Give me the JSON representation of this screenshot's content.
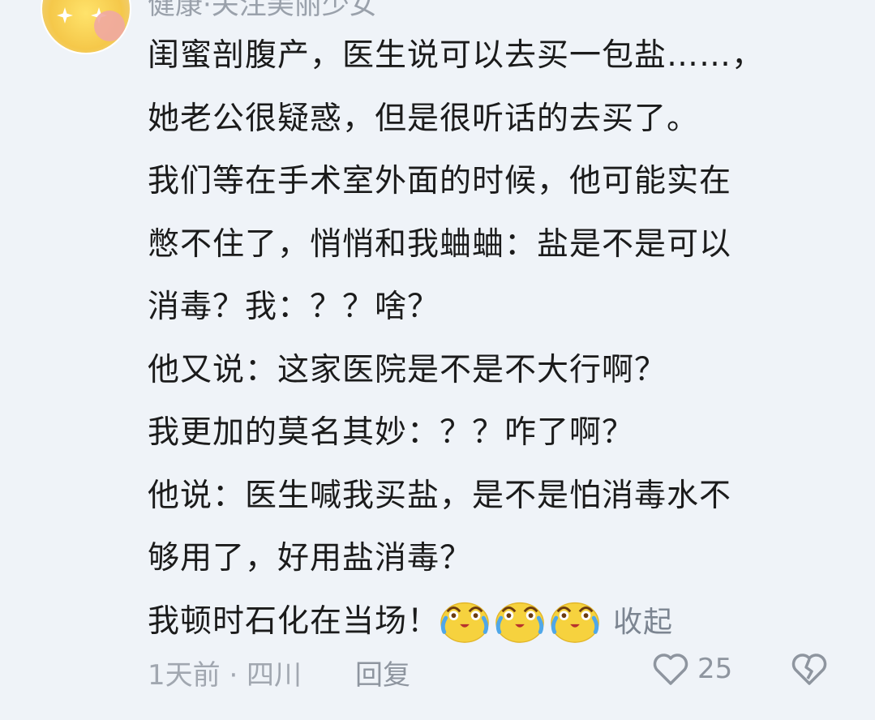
{
  "comment": {
    "author": "健康·关注美丽少女",
    "lines": [
      "闺蜜剖腹产，医生说可以去买一包盐……，",
      "她老公很疑惑，但是很听话的去买了。",
      "我们等在手术室外面的时候，他可能实在",
      "憋不住了，悄悄和我蛐蛐：盐是不是可以",
      "消毒？我：？？啥？",
      "他又说：这家医院是不是不大行啊？",
      "我更加的莫名其妙：？？咋了啊？",
      "他说：医生喊我买盐，是不是怕消毒水不",
      "够用了，好用盐消毒？",
      "我顿时石化在当场！"
    ],
    "emojis": [
      "crying-laughing-emoji",
      "crying-laughing-emoji",
      "crying-laughing-emoji"
    ],
    "collapse_label": "收起",
    "time_location": "1天前 · 四川",
    "reply_label": "回复",
    "like_count": "25"
  },
  "colors": {
    "background": "#eff3f8",
    "text": "#1b1b1b",
    "muted": "#a1a7b0",
    "emoji": "#f6d23e"
  },
  "icons": {
    "like": "heart-outline-icon",
    "dislike": "broken-heart-icon"
  }
}
